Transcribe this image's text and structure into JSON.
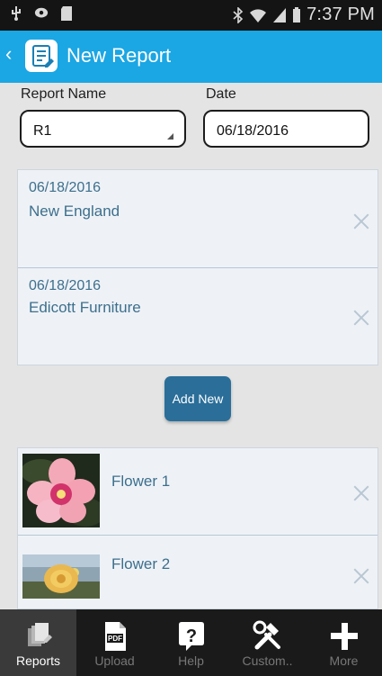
{
  "status_bar": {
    "time": "7:37 PM"
  },
  "app_bar": {
    "back_glyph": "‹",
    "title": "New Report"
  },
  "form": {
    "report_name_label": "Report Name",
    "report_name_value": "R1",
    "date_label": "Date",
    "date_value": "06/18/2016"
  },
  "reports": [
    {
      "date": "06/18/2016",
      "name": "New England"
    },
    {
      "date": "06/18/2016",
      "name": "Edicott Furniture"
    }
  ],
  "add_button_label": "Add New",
  "photos": [
    {
      "name": "Flower 1"
    },
    {
      "name": "Flower 2"
    }
  ],
  "bottom_nav": [
    {
      "label": "Reports",
      "icon": "reports-icon",
      "active": true
    },
    {
      "label": "Upload",
      "icon": "pdf-icon",
      "active": false
    },
    {
      "label": "Help",
      "icon": "help-icon",
      "active": false
    },
    {
      "label": "Custom..",
      "icon": "tools-icon",
      "active": false
    },
    {
      "label": "More",
      "icon": "plus-icon",
      "active": false
    }
  ],
  "colors": {
    "accent": "#1ba6e4",
    "button": "#2a6e99",
    "text_link": "#3d6f8c"
  }
}
